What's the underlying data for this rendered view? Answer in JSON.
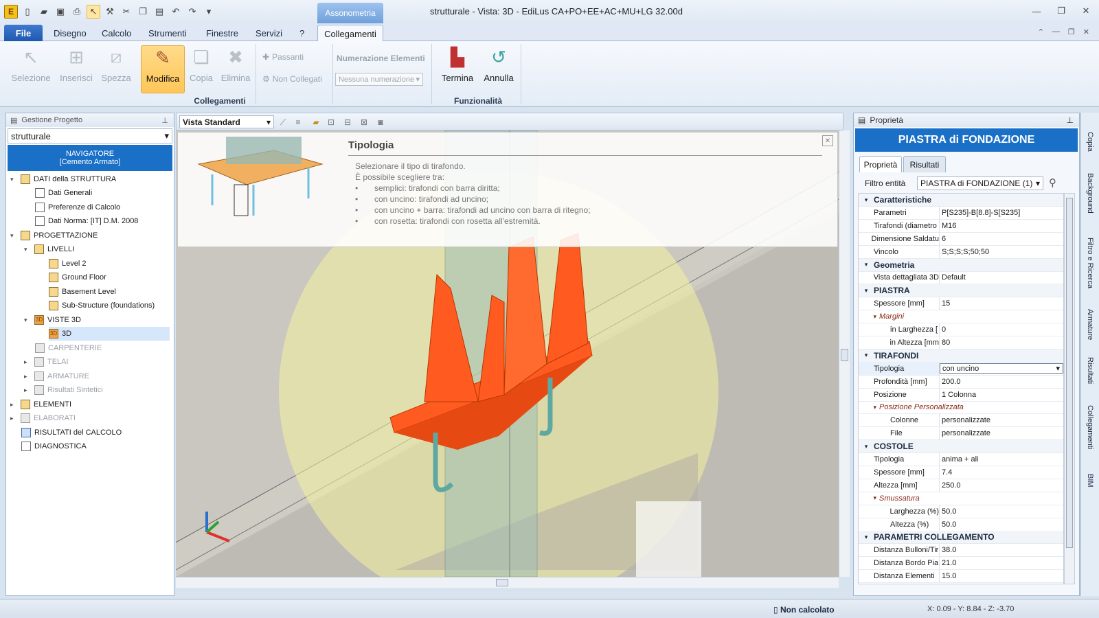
{
  "window": {
    "title": "strutturale - Vista: 3D - EdiLus CA+PO+EE+AC+MU+LG 32.00d",
    "context_tab": "Assonometria"
  },
  "menu": {
    "file": "File",
    "tabs": [
      "Disegno",
      "Calcolo",
      "Strumenti",
      "Finestre",
      "Servizi",
      "?"
    ],
    "active_tab": "Collegamenti"
  },
  "ribbon": {
    "collegamenti": {
      "label": "Collegamenti",
      "buttons": [
        "Selezione",
        "Inserisci",
        "Spezza",
        "Modifica",
        "Copia",
        "Elimina"
      ],
      "passanti": "Passanti",
      "non_collegati": "Non Collegati",
      "numerazione_label": "Numerazione Elementi",
      "numerazione_value": "Nessuna numerazione"
    },
    "funzionalita": {
      "label": "Funzionalità",
      "buttons": [
        "Termina",
        "Annulla"
      ]
    }
  },
  "left_panel": {
    "header": "Gestione Progetto",
    "project": "strutturale",
    "navigator_line1": "NAVIGATORE",
    "navigator_line2": "[Cemento Armato]",
    "tree": [
      "DATI della STRUTTURA",
      "Dati Generali",
      "Preferenze di Calcolo",
      "Dati Norma: [IT] D.M. 2008",
      "PROGETTAZIONE",
      "LIVELLI",
      "Level 2",
      "Ground Floor",
      "Basement Level",
      "Sub-Structure (foundations)",
      "VISTE 3D",
      "3D",
      "CARPENTERIE",
      "TELAI",
      "ARMATURE",
      "Risultati Sintetici",
      "ELEMENTI",
      "ELABORATI",
      "RISULTATI del CALCOLO",
      "DIAGNOSTICA"
    ]
  },
  "view": {
    "mode": "Vista Standard"
  },
  "tooltip": {
    "title": "Tipologia",
    "lines": [
      "Selezionare il tipo di tirafondo.",
      "È possibile scegliere tra:",
      "semplici: tirafondi con barra diritta;",
      "con uncino: tirafondi ad uncino;",
      "con uncino + barra: tirafondi ad uncino con barra di ritegno;",
      "con rosetta: tirafondi con rosetta all'estremità."
    ],
    "bullet": "•"
  },
  "properties": {
    "header": "Proprietà",
    "title": "PIASTRA di FONDAZIONE",
    "tabs": [
      "Proprietà",
      "Risultati"
    ],
    "filter_label": "Filtro entità",
    "filter_value": "PIASTRA di FONDAZIONE (1)",
    "rows": [
      {
        "k": "Caratteristiche",
        "v": "",
        "t": "cat"
      },
      {
        "k": "Parametri",
        "v": "P[S235]-B[8.8]-S[S235]",
        "t": "row"
      },
      {
        "k": "Tirafondi (diametro",
        "v": "M16",
        "t": "row"
      },
      {
        "k": "Dimensione Saldatu",
        "v": "6",
        "t": "row"
      },
      {
        "k": "Vincolo",
        "v": "S;S;S;S;50;50",
        "t": "row"
      },
      {
        "k": "Geometria",
        "v": "",
        "t": "cat"
      },
      {
        "k": "Vista dettagliata 3D",
        "v": "Default",
        "t": "row"
      },
      {
        "k": "PIASTRA",
        "v": "",
        "t": "cat"
      },
      {
        "k": "Spessore  [mm]",
        "v": "15",
        "t": "row"
      },
      {
        "k": "Margini",
        "v": "",
        "t": "sub"
      },
      {
        "k": "in Larghezza  [",
        "v": "0",
        "t": "row2"
      },
      {
        "k": "in Altezza  [mm",
        "v": "80",
        "t": "row2"
      },
      {
        "k": "TIRAFONDI",
        "v": "",
        "t": "cat"
      },
      {
        "k": "Tipologia",
        "v": "con uncino",
        "t": "edit"
      },
      {
        "k": "Profondità  [mm]",
        "v": "200.0",
        "t": "row"
      },
      {
        "k": "Posizione",
        "v": "1 Colonna",
        "t": "row"
      },
      {
        "k": "Posizione Personalizzata",
        "v": "",
        "t": "sub"
      },
      {
        "k": "Colonne",
        "v": "personalizzate",
        "t": "row2"
      },
      {
        "k": "File",
        "v": "personalizzate",
        "t": "row2"
      },
      {
        "k": "COSTOLE",
        "v": "",
        "t": "cat"
      },
      {
        "k": "Tipologia",
        "v": "anima + ali",
        "t": "row"
      },
      {
        "k": "Spessore  [mm]",
        "v": "7.4",
        "t": "row"
      },
      {
        "k": "Altezza  [mm]",
        "v": "250.0",
        "t": "row"
      },
      {
        "k": "Smussatura",
        "v": "",
        "t": "sub"
      },
      {
        "k": "Larghezza (%)",
        "v": "50.0",
        "t": "row2"
      },
      {
        "k": "Altezza  (%)",
        "v": "50.0",
        "t": "row2"
      },
      {
        "k": "PARAMETRI COLLEGAMENTO",
        "v": "",
        "t": "cat"
      },
      {
        "k": "Distanza Bulloni/Tir",
        "v": "38.0",
        "t": "row"
      },
      {
        "k": "Distanza Bordo Pia",
        "v": "21.0",
        "t": "row"
      },
      {
        "k": "Distanza Elementi",
        "v": "15.0",
        "t": "row"
      }
    ]
  },
  "side_tabs": [
    "Copia",
    "Background",
    "Filtro e Ricerca",
    "Armature",
    "Risultati",
    "Collegamenti",
    "BIM"
  ],
  "status": {
    "calc": "Non calcolato",
    "coords": "X: 0.09 - Y: 8.84 - Z: -3.70"
  },
  "colors": {
    "accent": "#1a6fc7",
    "plate": "#ff5a1f",
    "selection": "#ffc658"
  }
}
